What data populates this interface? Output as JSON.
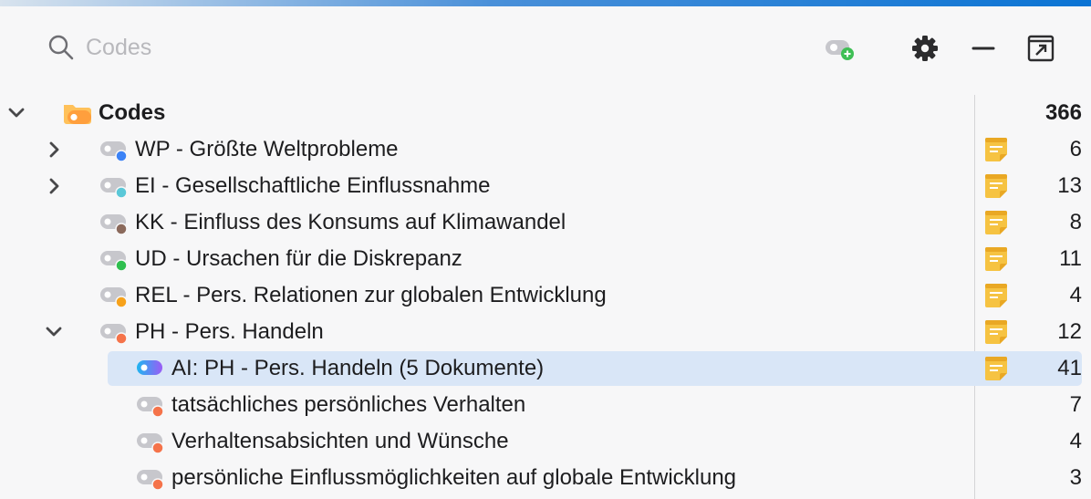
{
  "search": {
    "placeholder": "Codes"
  },
  "toolbar": {
    "new_code_icon": "code-add-icon",
    "settings_icon": "gear-icon",
    "collapse_icon": "minus-icon",
    "popout_icon": "open-external-icon"
  },
  "root": {
    "label": "Codes",
    "count": "366",
    "expanded": true
  },
  "rows": [
    {
      "label": "WP - Größte Weltprobleme",
      "count": "6",
      "color": "#3b82f6",
      "chevron": "right",
      "memo": true
    },
    {
      "label": "EI - Gesellschaftliche Einflussnahme",
      "count": "13",
      "color": "#5ac8d8",
      "chevron": "right",
      "memo": true
    },
    {
      "label": "KK - Einfluss des Konsums auf Klimawandel",
      "count": "8",
      "color": "#8b6a5c",
      "chevron": "none",
      "memo": true
    },
    {
      "label": "UD - Ursachen für die Diskrepanz",
      "count": "11",
      "color": "#2fbf4f",
      "chevron": "none",
      "memo": true
    },
    {
      "label": "REL - Pers. Relationen zur globalen Entwicklung",
      "count": "4",
      "color": "#f7a21b",
      "chevron": "none",
      "memo": true
    },
    {
      "label": "PH - Pers. Handeln",
      "count": "12",
      "color": "#f5734a",
      "chevron": "down",
      "memo": true
    },
    {
      "label": "AI: PH - Pers. Handeln (5 Dokumente)",
      "count": "41",
      "color": "ai-gradient",
      "chevron": "none",
      "memo": true,
      "selected": true
    },
    {
      "label": "tatsächliches persönliches Verhalten",
      "count": "7",
      "color": "#f5734a",
      "chevron": "none",
      "memo": false
    },
    {
      "label": "Verhaltensabsichten und Wünsche",
      "count": "4",
      "color": "#f5734a",
      "chevron": "none",
      "memo": false
    },
    {
      "label": "persönliche Einflussmöglichkeiten auf globale Entwicklung",
      "count": "3",
      "color": "#f5734a",
      "chevron": "none",
      "memo": false
    }
  ],
  "colors": {
    "memo": "#f6c342",
    "accent": "#0b74d4",
    "selection": "#d9e6f7"
  }
}
